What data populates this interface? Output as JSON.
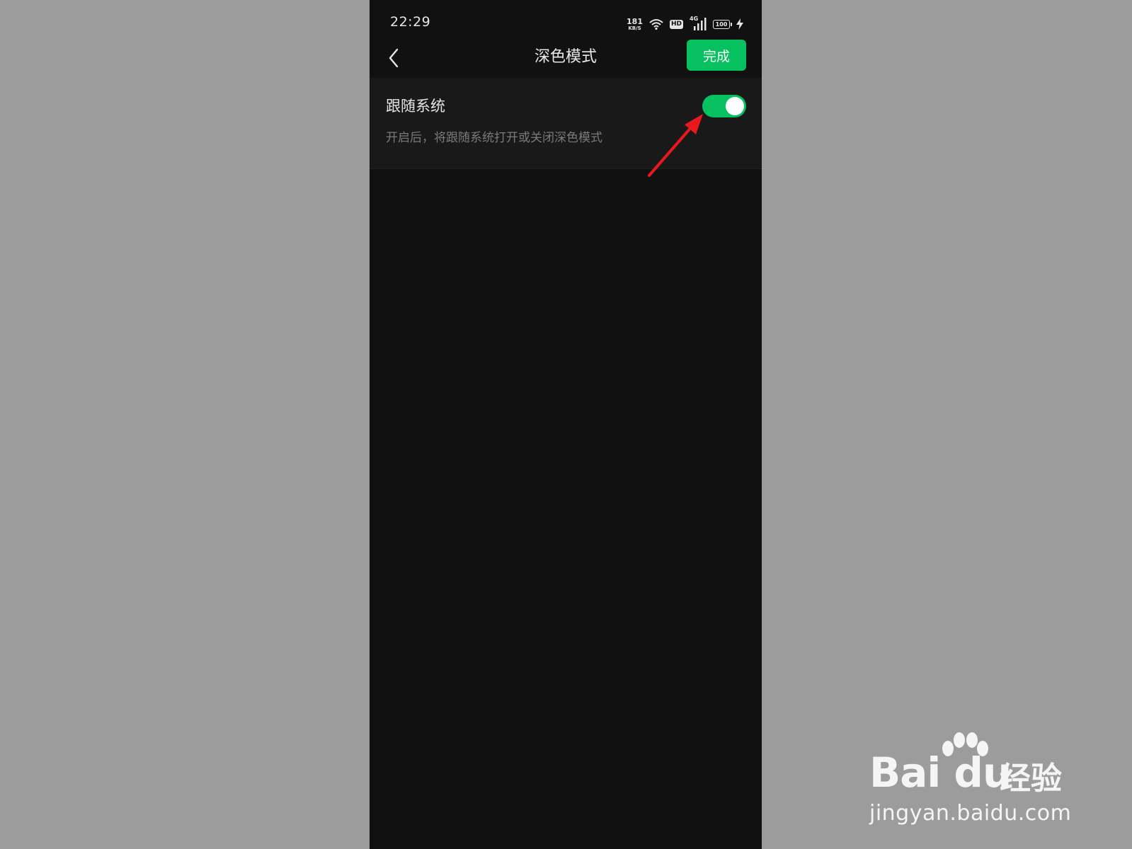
{
  "status_bar": {
    "time": "22:29",
    "net_speed_value": "181",
    "net_speed_unit": "KB/S",
    "hd_badge": "HD",
    "signal_type": "4G",
    "battery_level": "100",
    "icons": [
      "wifi-icon",
      "hd-icon",
      "signal-4g-icon",
      "battery-icon",
      "charging-icon"
    ]
  },
  "nav": {
    "title": "深色模式",
    "back_icon": "chevron-left-icon",
    "done_label": "完成"
  },
  "setting": {
    "title": "跟随系统",
    "description": "开启后，将跟随系统打开或关闭深色模式",
    "toggle_on": true
  },
  "watermark": {
    "brand": "Bai du",
    "cn": "经验",
    "url": "jingyan.baidu.com"
  },
  "colors": {
    "accent_green": "#07c160",
    "background": "#111111",
    "card_background": "#191919",
    "outer_background": "#9c9c9c",
    "annotation_red": "#e8191c"
  }
}
